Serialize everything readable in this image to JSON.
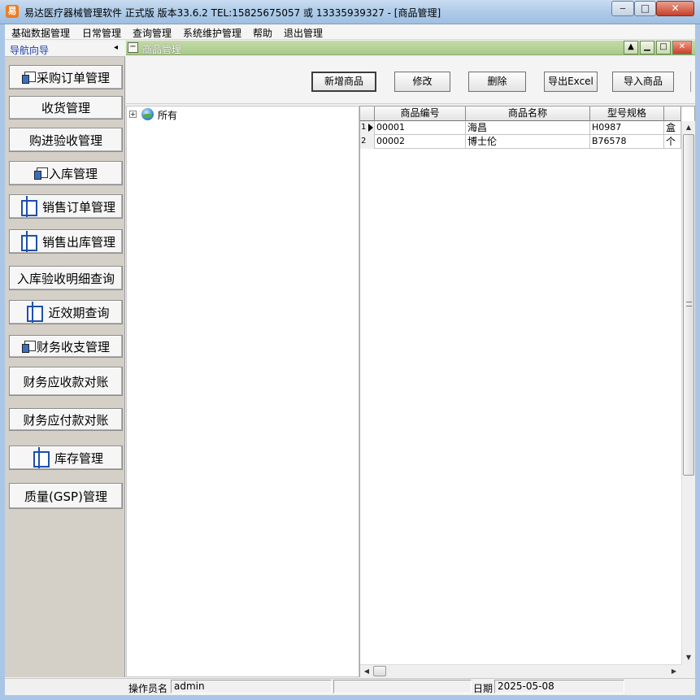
{
  "window": {
    "app_icon": "易",
    "title": "易达医疗器械管理软件 正式版 版本33.6.2    TEL:15825675057 或 13335939327  - [商品管理]",
    "min": "‒",
    "max": "□",
    "close": "✕"
  },
  "menu": [
    "基础数据管理",
    "日常管理",
    "查询管理",
    "系统维护管理",
    "帮助",
    "退出管理"
  ],
  "nav": {
    "title": "导航向导",
    "collapse": "◂",
    "items": [
      {
        "label": "采购订单管理",
        "icon": "card-icon"
      },
      {
        "label": "收货管理",
        "icon": ""
      },
      {
        "label": "购进验收管理",
        "icon": ""
      },
      {
        "label": "入库管理",
        "icon": "card-icon"
      },
      {
        "label": "销售订单管理",
        "icon": "book-icon"
      },
      {
        "label": "销售出库管理",
        "icon": "book-icon"
      },
      {
        "label": "入库验收明细查询",
        "icon": ""
      },
      {
        "label": "近效期查询",
        "icon": "book-icon"
      },
      {
        "label": "财务收支管理",
        "icon": "card-icon"
      },
      {
        "label": "财务应收款对账",
        "icon": ""
      },
      {
        "label": "财务应付款对账",
        "icon": ""
      },
      {
        "label": "库存管理",
        "icon": "book-icon"
      },
      {
        "label": "质量(GSP)管理",
        "icon": ""
      }
    ]
  },
  "panel": {
    "title": "商品管理",
    "collapse": "−"
  },
  "toolbar": {
    "add": "新增商品",
    "edit": "修改",
    "delete": "删除",
    "export": "导出Excel",
    "import": "导入商品"
  },
  "tree": {
    "expander": "+",
    "root": "所有"
  },
  "grid": {
    "columns": [
      "商品编号",
      "商品名称",
      "型号规格",
      ""
    ],
    "rows": [
      {
        "index": "1",
        "code": "00001",
        "name": "海昌",
        "spec": "H0987",
        "extra": "盒"
      },
      {
        "index": "2",
        "code": "00002",
        "name": "博士伦",
        "spec": "B76578",
        "extra": "个"
      }
    ]
  },
  "status": {
    "operator_label": "操作员名",
    "operator": "admin",
    "date_label": "日期",
    "date": "2025-05-08"
  }
}
